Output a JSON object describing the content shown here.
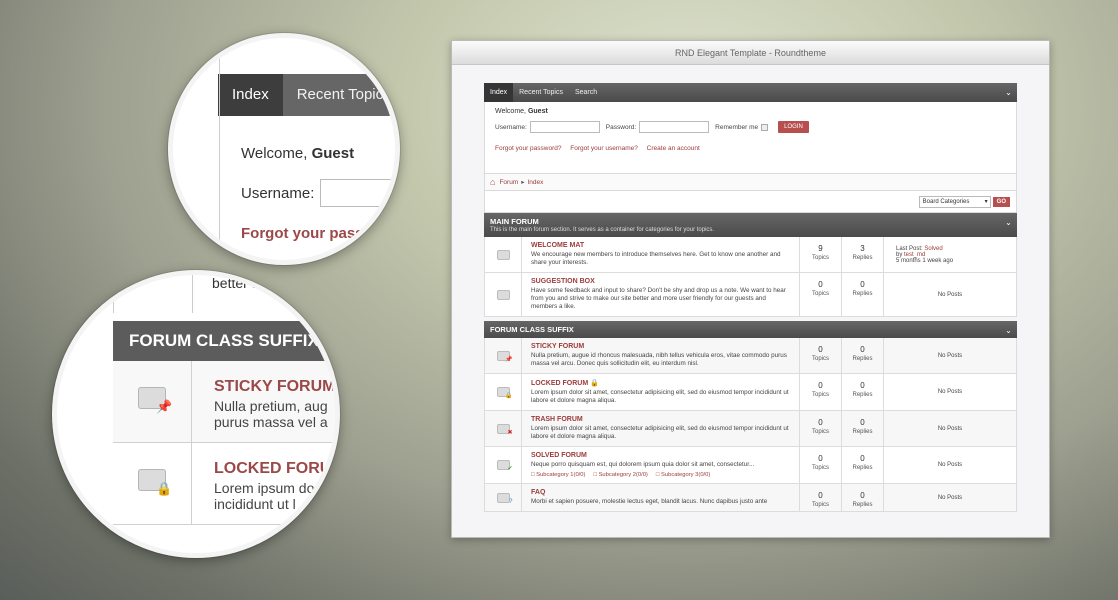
{
  "window": {
    "title": "RND Elegant Template - Roundtheme"
  },
  "nav": {
    "items": [
      "Index",
      "Recent Topics",
      "Search"
    ]
  },
  "login": {
    "welcome_prefix": "Welcome,",
    "user": "Guest",
    "username_label": "Username:",
    "password_label": "Password:",
    "remember_label": "Remember me",
    "login_button": "LOGIN",
    "forgot_password": "Forgot your password?",
    "forgot_username": "Forgot your username?",
    "create_account": "Create an account"
  },
  "breadcrumb": {
    "items": [
      "Forum",
      "Index"
    ],
    "separator": "▸"
  },
  "jump": {
    "selected": "Board Categories",
    "go": "GO"
  },
  "labels": {
    "topics": "Topics",
    "replies": "Replies",
    "no_posts": "No Posts",
    "last_post": "Last Post:",
    "by": "by"
  },
  "categories": [
    {
      "title": "MAIN FORUM",
      "desc": "This is the main forum section. It serves as a container for categories for your topics.",
      "forums": [
        {
          "title": "WELCOME MAT",
          "desc": "We encourage new members to introduce themselves here. Get to know one another and share your interests.",
          "topics": "9",
          "replies": "3",
          "last_title": "Solved",
          "last_user": "test_md",
          "last_time": "5 months 1 week ago"
        },
        {
          "title": "SUGGESTION BOX",
          "desc": "Have some feedback and input to share? Don't be shy and drop us a note. We want to hear from you and strive to make our site better and more user friendly for our guests and members a like.",
          "topics": "0",
          "replies": "0"
        }
      ]
    },
    {
      "title": "FORUM CLASS SUFFIX",
      "forums": [
        {
          "title": "STICKY FORUM",
          "desc": "Nulla pretium, augue id rhoncus malesuada, nibh tellus vehicula eros, vitae commodo purus massa vel arcu. Donec quis sollicitudin elit, eu interdum nisl.",
          "topics": "0",
          "replies": "0",
          "badge": "📌"
        },
        {
          "title": "LOCKED FORUM",
          "title_badge": "🔒",
          "desc": "Lorem ipsum dolor sit amet, consectetur adipisicing elit, sed do eiusmod tempor incididunt ut labore et dolore magna aliqua.",
          "topics": "0",
          "replies": "0",
          "badge": "🔒"
        },
        {
          "title": "TRASH FORUM",
          "desc": "Lorem ipsum dolor sit amet, consectetur adipisicing elit, sed do eiusmod tempor incididunt ut labore et dolore magna aliqua.",
          "topics": "0",
          "replies": "0",
          "badge": "✖"
        },
        {
          "title": "SOLVED FORUM",
          "desc": "Neque porro quisquam est, qui dolorem ipsum quia dolor sit amet, consectetur...",
          "topics": "0",
          "replies": "0",
          "badge": "✔",
          "subcats": [
            "Subcategory 1(0/0)",
            "Subcategory 2(0/0)",
            "Subcategory 3(0/0)"
          ]
        },
        {
          "title": "FAQ",
          "desc": "Morbi et sapien posuere, molestie lectus eget, blandit lacus. Nunc dapibus justo ante",
          "topics": "0",
          "replies": "0",
          "badge": "?"
        }
      ]
    }
  ],
  "zoom1": {
    "nav": [
      "Index",
      "Recent Topic"
    ],
    "welcome_prefix": "Welcome,",
    "user": "Guest",
    "username_label": "Username:",
    "forgot": "Forgot your pass"
  },
  "zoom2": {
    "top_text": "better a",
    "head": "FORUM CLASS SUFFIX",
    "rows": [
      {
        "title": "STICKY FORUM",
        "desc1": "Nulla pretium, aug",
        "desc2": "purus massa vel a",
        "badge": "📌"
      },
      {
        "title": "LOCKED FORU",
        "desc1": "Lorem ipsum do",
        "desc2": "incididunt ut l",
        "badge": "🔒"
      }
    ]
  },
  "colors": {
    "accent": "#9b3b3b",
    "button": "#b84f4f",
    "header": "#555555"
  }
}
